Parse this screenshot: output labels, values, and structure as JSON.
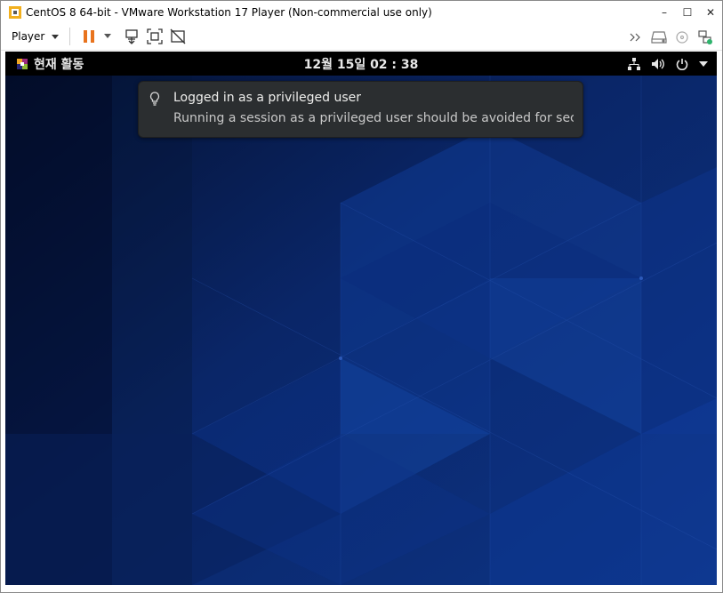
{
  "window": {
    "title": "CentOS 8 64-bit - VMware Workstation 17 Player (Non-commercial use only)",
    "minimize_glyph": "–",
    "maximize_glyph": "☐",
    "close_glyph": "✕"
  },
  "toolbar": {
    "player_label": "Player",
    "accent_color": "#e8731d",
    "left_icons": [
      "pause-icon",
      "dropdown-icon",
      "send-ctrl-alt-del-icon",
      "fit-guest-icon",
      "unity-icon"
    ],
    "right_icons": [
      "forward-icon",
      "hard-disk-icon",
      "cd-dvd-icon",
      "network-adapter-icon"
    ]
  },
  "gnome": {
    "activities_label": "현재 활동",
    "clock": "12월 15일  02 : 38",
    "status_icons": [
      "network-wired-icon",
      "volume-icon",
      "power-icon",
      "menu-arrow-icon"
    ]
  },
  "notification": {
    "icon": "lightbulb-icon",
    "title": "Logged in as a privileged user",
    "body": "Running a session as a privileged user should be avoided for securit⋯"
  },
  "colors": {
    "desktop_base": "#0b2a72",
    "panel": "#000000",
    "notification_bg": "#2b2e30"
  }
}
